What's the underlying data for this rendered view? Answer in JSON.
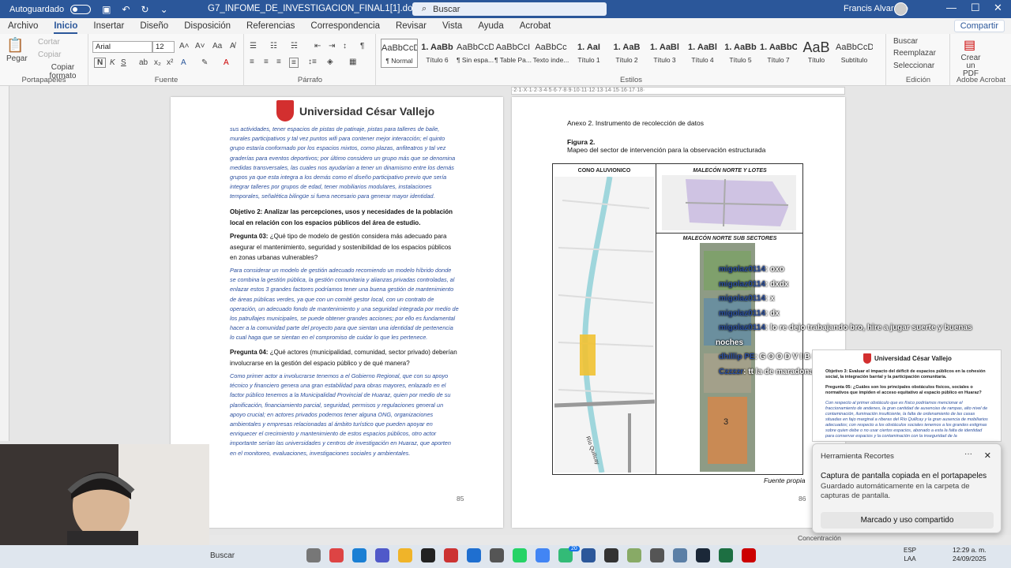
{
  "titlebar": {
    "autosave_label": "Autoguardado",
    "doc_title": "G7_INFOME_DE_INVESTIGACION_FINAL1[1].docx",
    "search_placeholder": "Buscar",
    "user_name": "Francis Alvarado",
    "controls": [
      "—",
      "☐",
      "✕"
    ]
  },
  "menu": {
    "tabs": [
      "Archivo",
      "Inicio",
      "Insertar",
      "Diseño",
      "Disposición",
      "Referencias",
      "Correspondencia",
      "Revisar",
      "Vista",
      "Ayuda",
      "Acrobat"
    ],
    "active": "Inicio",
    "share_label": "Compartir"
  },
  "ribbon": {
    "clipboard": {
      "paste": "Pegar",
      "cut": "Cortar",
      "copy": "Copiar",
      "format_painter": "Copiar formato",
      "label": "Portapapeles"
    },
    "font": {
      "family": "Arial",
      "size": "12",
      "label": "Fuente"
    },
    "paragraph": {
      "label": "Párrafo"
    },
    "styles": {
      "label": "Estilos",
      "items": [
        {
          "preview": "AaBbCcDc",
          "name": "¶ Normal"
        },
        {
          "preview": "1. AaBb",
          "name": "Título 6"
        },
        {
          "preview": "AaBbCcDc",
          "name": "¶ Sin espa..."
        },
        {
          "preview": "AaBbCcI",
          "name": "¶ Table Pa..."
        },
        {
          "preview": "AaBbCc",
          "name": "Texto inde..."
        },
        {
          "preview": "1. AaI",
          "name": "Título 1"
        },
        {
          "preview": "1. AaB",
          "name": "Título 2"
        },
        {
          "preview": "1. AaBl",
          "name": "Título 3"
        },
        {
          "preview": "1. AaBl",
          "name": "Título 4"
        },
        {
          "preview": "1. AaBb",
          "name": "Título 5"
        },
        {
          "preview": "1. AaBbC",
          "name": "Título 7"
        },
        {
          "preview": "AaB",
          "name": "Título"
        },
        {
          "preview": "AaBbCcD",
          "name": "Subtítulo"
        }
      ]
    },
    "editing": {
      "find": "Buscar",
      "replace": "Reemplazar",
      "select": "Seleccionar",
      "label": "Edición"
    },
    "acrobat": {
      "create_pdf": "Crear un PDF",
      "label": "Adobe Acrobat"
    }
  },
  "page85": {
    "university": "Universidad César Vallejo",
    "answer1": "sus actividades, tener espacios de pistas de patinaje, pistas para talleres de baile, murales participativos y tal vez puntos wifi para contener mejor interacción; el quinto grupo estaría conformado por los espacios mixtos, como plazas, anfiteatros y tal vez graderías para eventos deportivos; por último considero un grupo más que se denomina medidas transversales, las cuales nos ayudarían a tener un dinamismo entre los demás grupos ya que esta integra a los demás como el diseño participativo previo que sería integrar talleres por grupos de edad, tener mobiliarios modulares, instalaciones temporales, señalética bilingüe si fuera necesario para generar mayor identidad.",
    "objective2": "Objetivo 2: Analizar las percepciones, usos y necesidades de la población local en relación con los espacios públicos del área de estudio.",
    "q3_label": "Pregunta 03:",
    "q3_text": " ¿Qué tipo de modelo de gestión considera más adecuado para asegurar el mantenimiento, seguridad y sostenibilidad de los espacios públicos en zonas urbanas vulnerables?",
    "answer3": "Para considerar un modelo de gestión adecuado recomiendo un modelo híbrido donde se combina la gestión pública, la gestión comunitaria y alianzas privadas controladas, al enlazar estos 3 grandes factores podríamos tener una buena gestión de mantenimiento de áreas públicas verdes, ya que con un comité gestor local, con un contrato de operación, un adecuado fondo de mantenimiento y una seguridad integrada por medio de los patrullajes municipales, se puede obtener grandes acciones; por ello es fundamental hacer a la comunidad parte del proyecto para que sientan una identidad de pertenencia lo cual haga que se sientan en el compromiso de cuidar lo que les pertenece.",
    "q4_label": "Pregunta 04:",
    "q4_text": " ¿Qué actores (municipalidad, comunidad, sector privado) deberían involucrarse en la gestión del espacio público y de qué manera?",
    "answer4": "Como primer actor a involucrarse tenemos a el Gobierno Regional, que con su apoyo técnico y financiero genera una gran estabilidad para obras mayores, enlazado en el factor público tenemos a la Municipalidad Provincial de Huaraz, quien por medio de su planificación, financiamiento parcial, seguridad, permisos y regulaciones general un apoyo crucial; en actores privados podemos tener alguna ONG, organizaciones ambientales y empresas relacionadas al ámbito turístico que pueden apoyar en enriquecer el crecimiento y mantenimiento de estos espacios públicos, otro actor importante serían las universidades y centros de investigación en Huaraz, que aporten en el monitoreo, evaluaciones, investigaciones sociales y ambientales.",
    "page_number": "85"
  },
  "page86": {
    "annex": "Anexo 2.  Instrumento de recolección de datos",
    "figure_label": "Figura 2.",
    "figure_caption": "Mapeo del sector de intervención para la observación estructurada",
    "map_titles": [
      "CONO ALUVIONICO",
      "MALECÓN NORTE Y LOTES",
      "MALECÓN NORTE SUB SECTORES"
    ],
    "street_label": "Río Quillcay",
    "sector_number": "3",
    "source": "Fuente propia",
    "page_number": "86"
  },
  "chat": [
    {
      "user": "migolaz0114",
      "msg": ": oxo"
    },
    {
      "user": "migolaz0114",
      "msg": ": dxdx"
    },
    {
      "user": "migolaz0114",
      "msg": ": x"
    },
    {
      "user": "migolaz0114",
      "msg": ": dx"
    },
    {
      "user": "migolaz0114",
      "msg": ": lo re dejo trabajando bro, hire a jugar suerte y buenas"
    },
    {
      "user": "",
      "msg": "noches"
    },
    {
      "user": "dhillip PE",
      "msg": ": G O O D V I B E S  W Flo Miguel"
    },
    {
      "user": "Czzzzr",
      "msg": ": tt la de maradona?"
    }
  ],
  "preview": {
    "university": "Universidad César Vallejo",
    "lines": [
      "Objetivo 3: Evaluar el impacto del déficit de espacios públicos en la cohesión social, la integración barrial y la participación comunitaria.",
      "Pregunta 05: ¿Cuáles son los principales obstáculos físicos, sociales o normativos que impiden el acceso equitativo al espacio público en Huaraz?",
      "Con respecto al primer obstáculo que es físico podríamos mencionar el fraccionamiento de andenes, la gran cantidad de ausencias de rampas, alto nivel de contaminación, iluminación insuficiente, la falta de ordenamiento de las casas situadas en fajo marginal a riberas del Río Quillcay y la gran ausencia de mobiliarios adecuados; con respecto a los obstáculos sociales tenemos a los grandes estigmas sobre quien debe o no usar ciertos espacios, abonado a esta la falta de identidad para conservar espacios y la contaminación con la inseguridad de la"
    ]
  },
  "toast": {
    "app": "Herramienta Recortes",
    "title": "Captura de pantalla copiada en el portapapeles",
    "body": "Guardado automáticamente en la carpeta de capturas de pantalla.",
    "button": "Marcado y uso compartido"
  },
  "statusbar": {
    "focus": "Concentración"
  },
  "taskbar": {
    "search_placeholder": "Buscar",
    "language": "ESP",
    "region": "LAA",
    "time": "12:29 a. m.",
    "date": "24/09/2025",
    "badge": "20",
    "icons": [
      "task-view-icon",
      "opera-icon",
      "edge-icon",
      "teams-icon",
      "explorer-icon",
      "tiktok-icon",
      "app-icon",
      "outlook-icon",
      "camera-icon",
      "whatsapp-icon",
      "chrome-icon",
      "browser-icon",
      "word-icon",
      "obs-icon",
      "app2-icon",
      "back-icon",
      "settings-icon",
      "steam-icon",
      "excel-icon",
      "acrobat-icon"
    ]
  },
  "colors": {
    "word_blue": "#2b579a",
    "answer_blue": "#2b4f9e",
    "crest_red": "#d32f2f",
    "chat_blue": "#2b4f9e"
  }
}
